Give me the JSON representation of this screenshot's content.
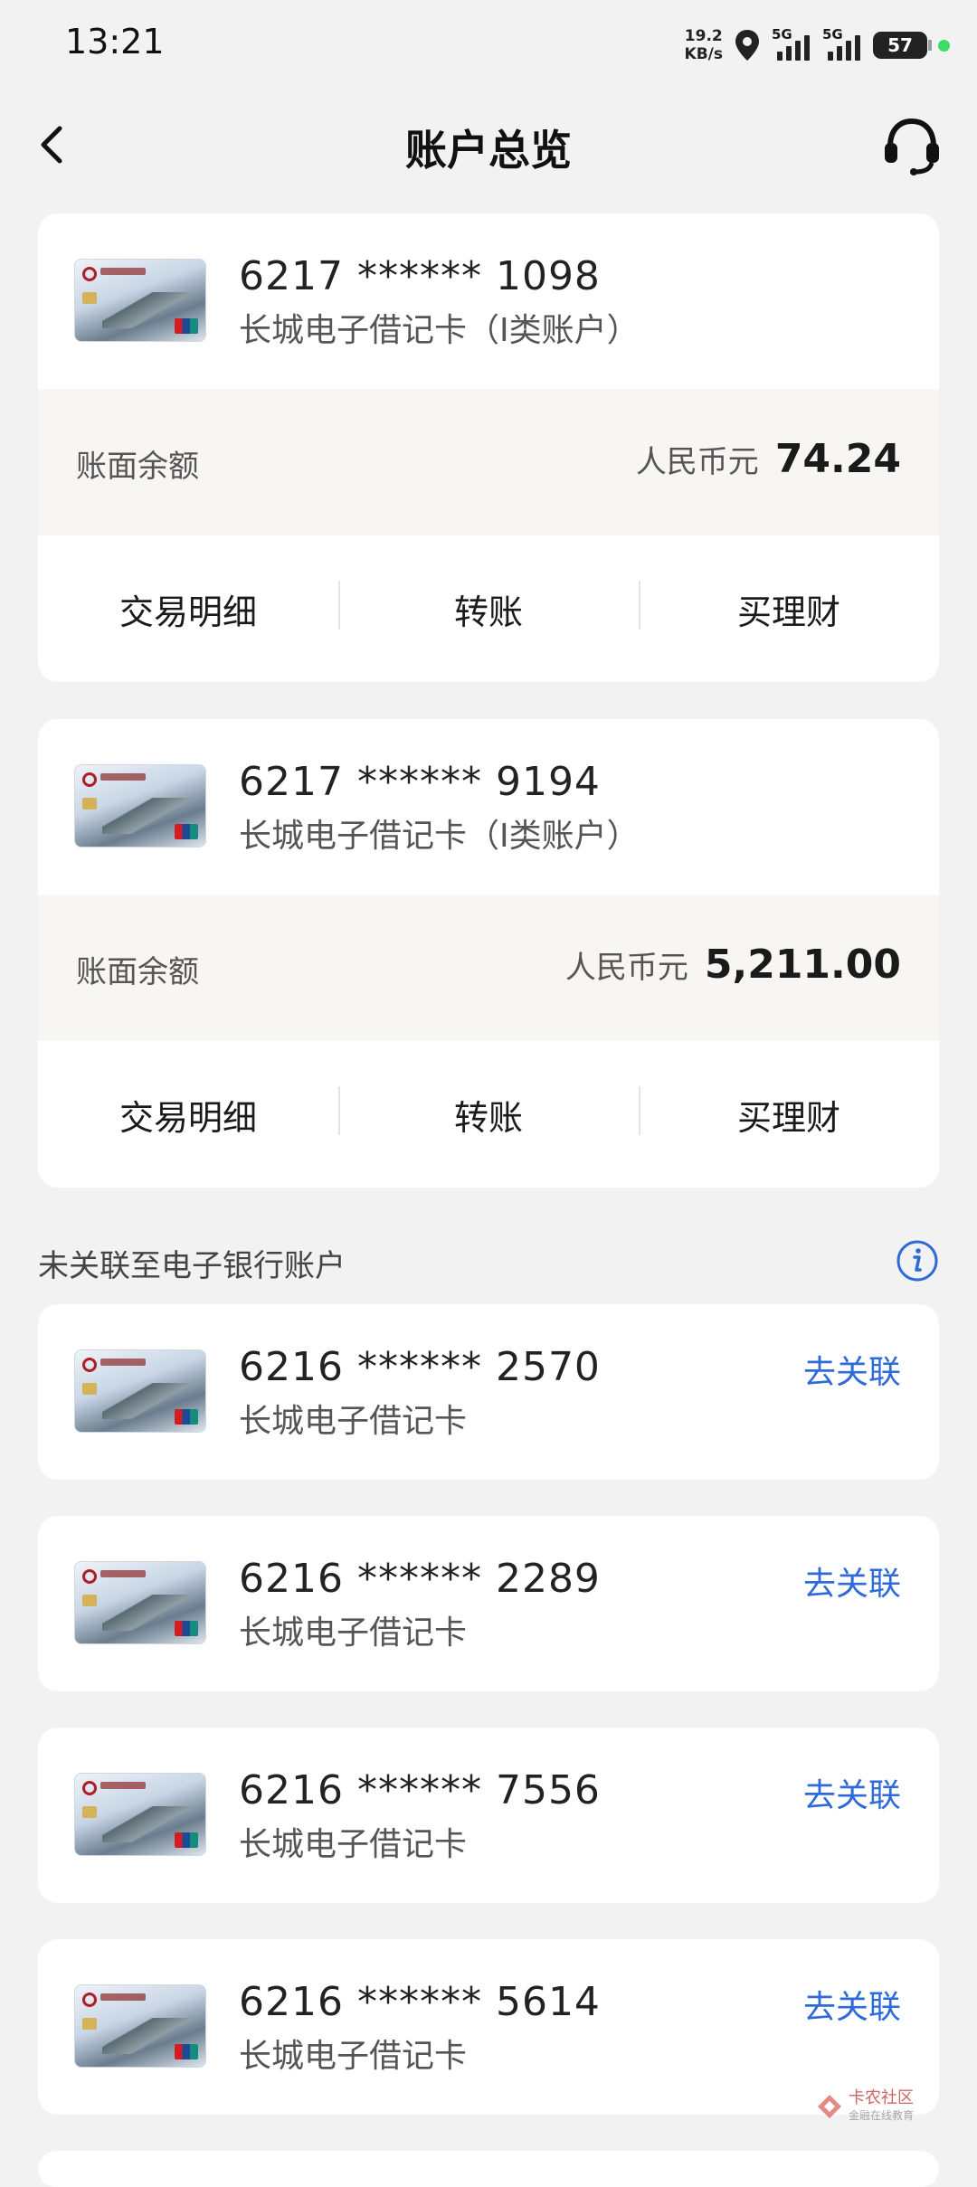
{
  "status_bar": {
    "time": "13:21",
    "net_speed_value": "19.2",
    "net_speed_unit": "KB/s",
    "signal_label_1": "5G",
    "signal_label_2": "5G",
    "battery": "57"
  },
  "header": {
    "title": "账户总览",
    "back_icon": "chevron-left-icon",
    "service_icon": "headset-icon"
  },
  "linked_accounts": [
    {
      "card_number": "6217 ****** 1098",
      "card_name": "长城电子借记卡（I类账户）",
      "balance_label": "账面余额",
      "currency": "人民币元",
      "balance": "74.24",
      "actions": [
        "交易明细",
        "转账",
        "买理财"
      ]
    },
    {
      "card_number": "6217 ****** 9194",
      "card_name": "长城电子借记卡（I类账户）",
      "balance_label": "账面余额",
      "currency": "人民币元",
      "balance": "5,211.00",
      "actions": [
        "交易明细",
        "转账",
        "买理财"
      ]
    }
  ],
  "unlinked_section": {
    "title": "未关联至电子银行账户",
    "info_icon": "info-icon"
  },
  "unlinked_accounts": [
    {
      "card_number": "6216 ****** 2570",
      "card_name": "长城电子借记卡",
      "link_label": "去关联"
    },
    {
      "card_number": "6216 ****** 2289",
      "card_name": "长城电子借记卡",
      "link_label": "去关联"
    },
    {
      "card_number": "6216 ****** 7556",
      "card_name": "长城电子借记卡",
      "link_label": "去关联"
    },
    {
      "card_number": "6216 ****** 5614",
      "card_name": "长城电子借记卡",
      "link_label": "去关联"
    }
  ],
  "watermark": {
    "title": "卡农社区",
    "subtitle": "金融在线教育"
  },
  "colors": {
    "accent": "#2f6bd8",
    "background": "#f2f2f2",
    "balance_bg": "#f8f6f3"
  }
}
